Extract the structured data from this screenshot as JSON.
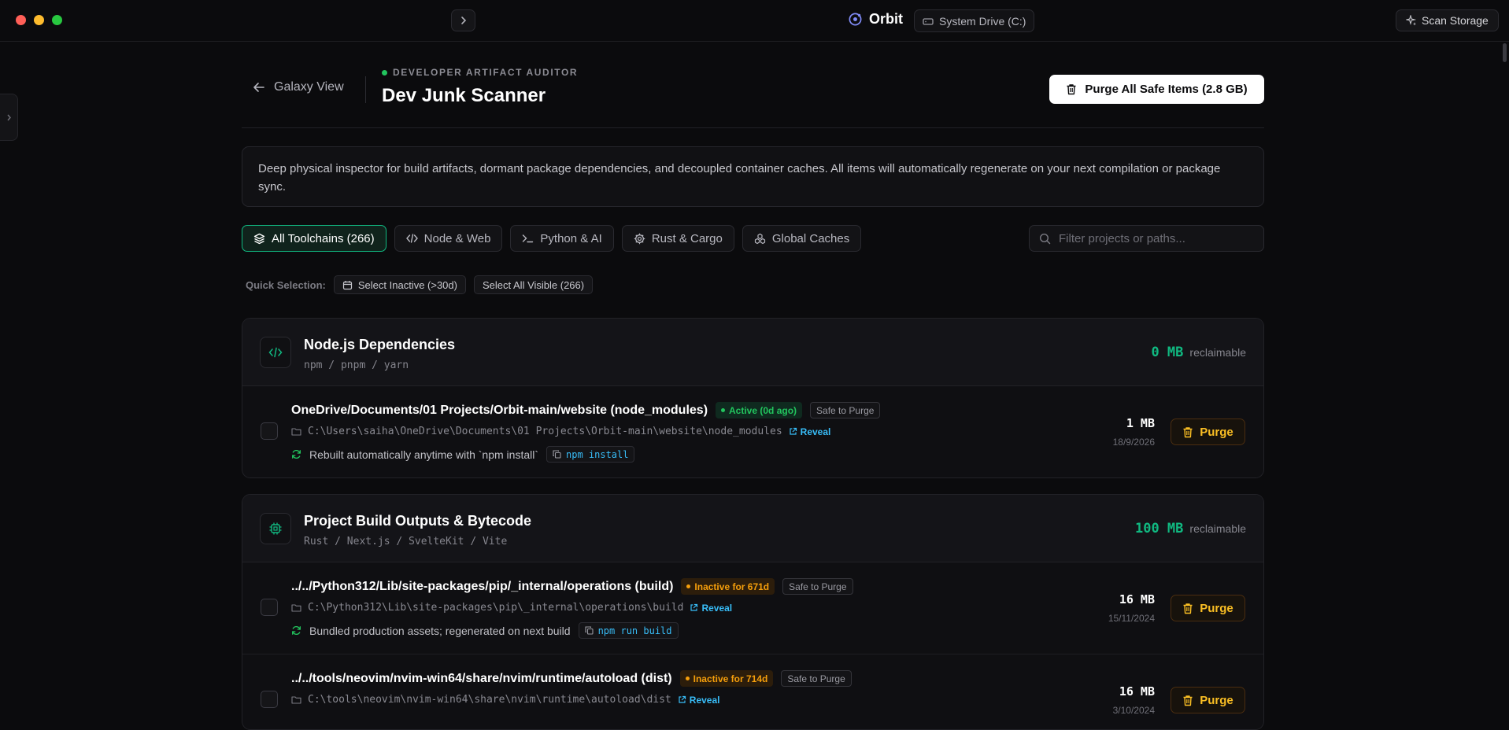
{
  "app": {
    "name": "Orbit",
    "drive": "System Drive (C:)",
    "scan_label": "Scan Storage"
  },
  "header": {
    "back_label": "Galaxy View",
    "eyebrow": "DEVELOPER ARTIFACT AUDITOR",
    "title": "Dev Junk Scanner",
    "purge_all_label": "Purge All Safe Items (2.8 GB)"
  },
  "description": "Deep physical inspector for build artifacts, dormant package dependencies, and decoupled container caches. All items will automatically regenerate on your next compilation or package sync.",
  "filters": {
    "all": "All Toolchains (266)",
    "node": "Node & Web",
    "python": "Python & AI",
    "rust": "Rust & Cargo",
    "global": "Global Caches"
  },
  "search": {
    "placeholder": "Filter projects or paths..."
  },
  "quick": {
    "label": "Quick Selection:",
    "inactive": "Select Inactive (>30d)",
    "visible": "Select All Visible (266)"
  },
  "reclaimable_label": "reclaimable",
  "groups": [
    {
      "title": "Node.js Dependencies",
      "subtitle": "npm / pnpm / yarn",
      "size": "0 MB",
      "items": [
        {
          "name": "OneDrive/Documents/01 Projects/Orbit-main/website (node_modules)",
          "status": "Active (0d ago)",
          "safe": "Safe to Purge",
          "path": "C:\\Users\\saiha\\OneDrive\\Documents\\01 Projects\\Orbit-main\\website\\node_modules",
          "reveal": "Reveal",
          "hint": "Rebuilt automatically anytime with `npm install`",
          "cmd": "npm install",
          "size": "1 MB",
          "date": "18/9/2026",
          "purge": "Purge"
        }
      ]
    },
    {
      "title": "Project Build Outputs & Bytecode",
      "subtitle": "Rust / Next.js / SvelteKit / Vite",
      "size": "100 MB",
      "items": [
        {
          "name": "../../Python312/Lib/site-packages/pip/_internal/operations (build)",
          "status": "Inactive for 671d",
          "safe": "Safe to Purge",
          "path": "C:\\Python312\\Lib\\site-packages\\pip\\_internal\\operations\\build",
          "reveal": "Reveal",
          "hint": "Bundled production assets; regenerated on next build",
          "cmd": "npm run build",
          "size": "16 MB",
          "date": "15/11/2024",
          "purge": "Purge"
        },
        {
          "name": "../../tools/neovim/nvim-win64/share/nvim/runtime/autoload (dist)",
          "status": "Inactive for 714d",
          "safe": "Safe to Purge",
          "path": "C:\\tools\\neovim\\nvim-win64\\share\\nvim\\runtime\\autoload\\dist",
          "reveal": "Reveal",
          "hint": "",
          "cmd": "",
          "size": "16 MB",
          "date": "3/10/2024",
          "purge": "Purge"
        }
      ]
    }
  ],
  "colors": {
    "accent": "#10b981",
    "warning": "#f59e0b",
    "link": "#38bdf8"
  }
}
